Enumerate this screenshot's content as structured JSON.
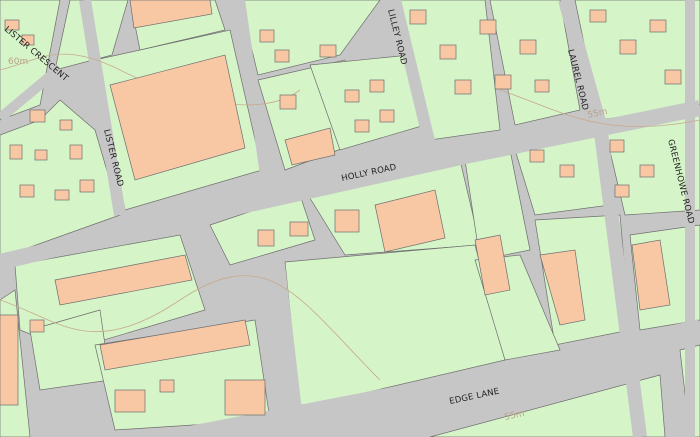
{
  "map": {
    "colors": {
      "road": "#c6c6c6",
      "land": "#d5f4c8",
      "building": "#f8c8a4",
      "outline": "#6e6e6e",
      "contour": "#c8a98e"
    },
    "road_labels": [
      {
        "id": "holly-road",
        "text": "HOLLY ROAD"
      },
      {
        "id": "edge-lane",
        "text": "EDGE LANE"
      },
      {
        "id": "lister-road",
        "text": "LISTER ROAD"
      },
      {
        "id": "lister-crescent",
        "text": "LISTER CRESCENT"
      },
      {
        "id": "lilley-road",
        "text": "LILLEY ROAD"
      },
      {
        "id": "laurel-road",
        "text": "LAUREL ROAD"
      },
      {
        "id": "greenhowe-road",
        "text": "GREENHOWE ROAD"
      }
    ],
    "spot_labels": [
      {
        "id": "sixty-top-left",
        "text": "60m"
      },
      {
        "id": "sixty-laurel",
        "text": "55m"
      },
      {
        "id": "sixty-edge",
        "text": "55m"
      }
    ]
  }
}
